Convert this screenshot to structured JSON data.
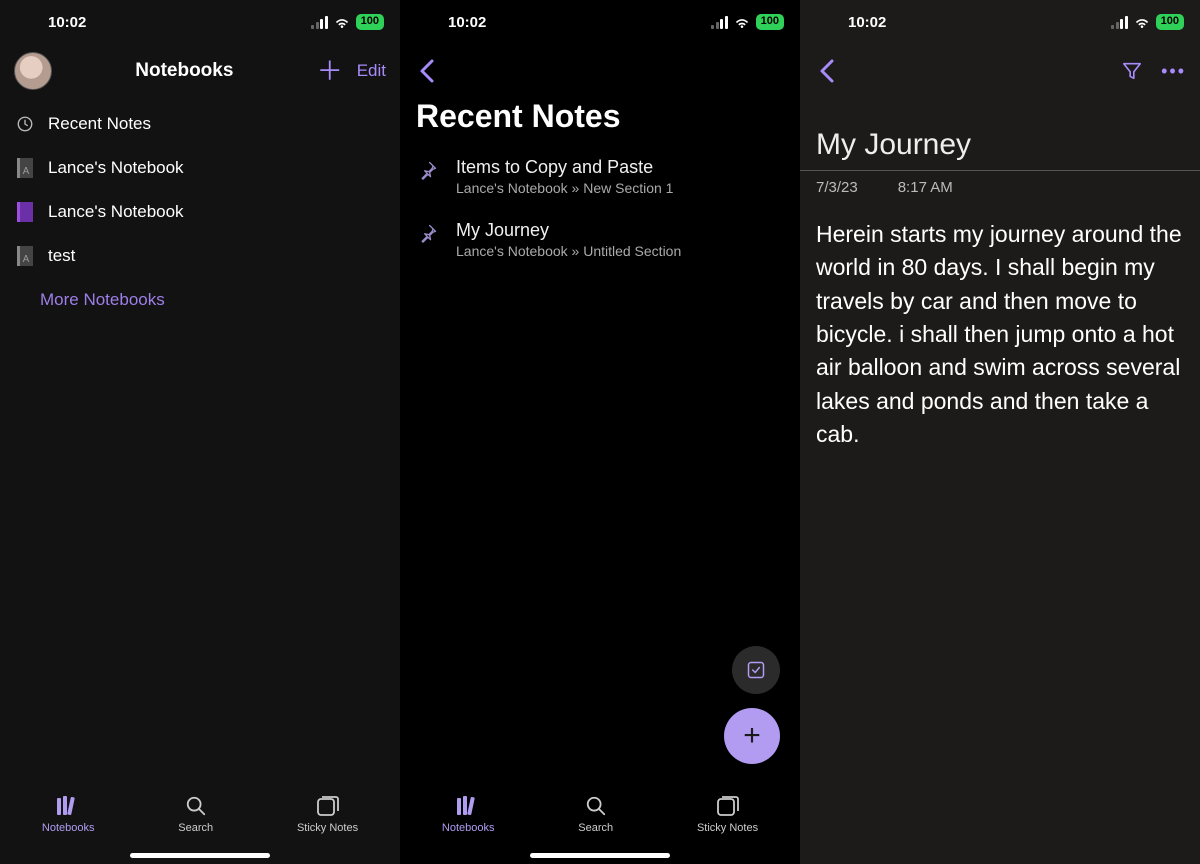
{
  "status": {
    "time": "10:02",
    "battery": "100"
  },
  "colors": {
    "accent": "#a78bfa",
    "battery_green": "#30d158",
    "fab_purple": "#b19cf2"
  },
  "panel1": {
    "title": "Notebooks",
    "edit_label": "Edit",
    "items": [
      {
        "label": "Recent Notes",
        "icon": "clock"
      },
      {
        "label": "Lance's Notebook",
        "icon": "notebook-grey"
      },
      {
        "label": "Lance's Notebook",
        "icon": "notebook-purple"
      },
      {
        "label": "test",
        "icon": "notebook-grey"
      }
    ],
    "more_label": "More Notebooks"
  },
  "panel2": {
    "title": "Recent Notes",
    "notes": [
      {
        "title": "Items to Copy and Paste",
        "sub": "Lance's Notebook » New Section 1"
      },
      {
        "title": "My Journey",
        "sub": "Lance's Notebook » Untitled Section"
      }
    ]
  },
  "tabs": [
    {
      "label": "Notebooks",
      "icon": "books",
      "active": true
    },
    {
      "label": "Search",
      "icon": "search",
      "active": false
    },
    {
      "label": "Sticky Notes",
      "icon": "sticky",
      "active": false
    }
  ],
  "note": {
    "title": "My Journey",
    "date": "7/3/23",
    "time": "8:17 AM",
    "body": "Herein starts my journey around the world in 80 days. I shall begin my travels by car and then move to bicycle. i shall then jump onto a hot air balloon and swim across several lakes and ponds and then take a cab."
  }
}
